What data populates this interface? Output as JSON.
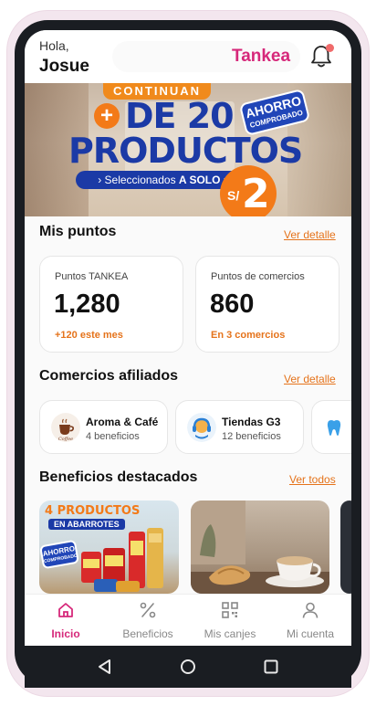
{
  "header": {
    "greeting": "Hola,",
    "user_name": "Josue",
    "brand": "Tankea"
  },
  "banner": {
    "badge_top": "CONTINUAN",
    "plus": "+",
    "line1": "DE 20",
    "line2": "PRODUCTOS",
    "pill_prefix": "› Seleccionados ",
    "pill_bold": "A SOLO",
    "pill_suffix": " ›",
    "currency": "S/",
    "price": "2",
    "ahorro_line1": "AHORRO",
    "ahorro_line2": "COMPROBADO"
  },
  "points_section": {
    "title": "Mis puntos",
    "link": "Ver detalle",
    "cards": [
      {
        "label": "Puntos TANKEA",
        "value": "1,280",
        "sub": "+120 este mes"
      },
      {
        "label": "Puntos de comercios",
        "value": "860",
        "sub": "En 3 comercios"
      }
    ]
  },
  "merchants_section": {
    "title": "Comercios afiliados",
    "link": "Ver detalle",
    "items": [
      {
        "name": "Aroma & Café",
        "benefits": "4 beneficios",
        "icon": "coffee-icon"
      },
      {
        "name": "Tiendas G3",
        "benefits": "12 beneficios",
        "icon": "headset-icon"
      },
      {
        "name": "",
        "benefits": "",
        "icon": "tooth-icon"
      }
    ]
  },
  "benefits_section": {
    "title": "Beneficios destacados",
    "link": "Ver todos",
    "promo_line1": "4 PRODUCTOS",
    "promo_line2": "EN ABARROTES",
    "promo_ahorro1": "AHORRO",
    "promo_ahorro2": "COMPROBADO"
  },
  "bottom_nav": [
    {
      "label": "Inicio",
      "icon": "home-icon",
      "active": true
    },
    {
      "label": "Beneficios",
      "icon": "percent-icon",
      "active": false
    },
    {
      "label": "Mis canjes",
      "icon": "qr-icon",
      "active": false
    },
    {
      "label": "Mi cuenta",
      "icon": "user-icon",
      "active": false
    }
  ],
  "colors": {
    "brand": "#d6287a",
    "accent": "#e5731b",
    "banner_blue": "#1b3aa6",
    "banner_orange": "#f37a18"
  }
}
